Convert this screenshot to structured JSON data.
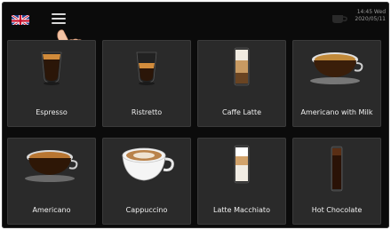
{
  "header": {
    "language_icon": "uk-flag-icon",
    "menu_icon": "hamburger-menu-icon",
    "time": "14:45 Wed",
    "date": "2020/05/11"
  },
  "products": [
    {
      "label": "Espresso"
    },
    {
      "label": "Ristretto"
    },
    {
      "label": "Caffe Latte"
    },
    {
      "label": "Americano with Milk"
    },
    {
      "label": "Americano"
    },
    {
      "label": "Cappuccino"
    },
    {
      "label": "Latte Macchiato"
    },
    {
      "label": "Hot Chocolate"
    }
  ]
}
